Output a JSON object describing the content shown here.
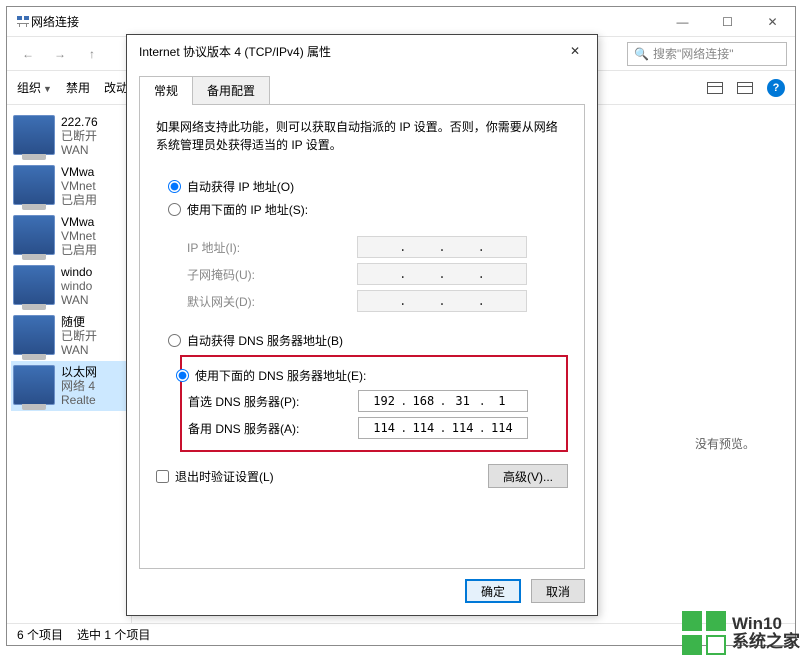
{
  "explorer": {
    "title": "网络连接",
    "search_placeholder": "搜索\"网络连接\"",
    "cmdbar": {
      "organize_label": "组织",
      "disable_label": "禁用",
      "changed_label": "改动的"
    },
    "no_preview": "没有预览。",
    "status": {
      "count": "6 个项目",
      "selected": "选中 1 个项目"
    },
    "items": [
      {
        "name": "222.76",
        "status": "已断开",
        "device": "WAN"
      },
      {
        "name": "VMwa",
        "status": "VMnet",
        "device": "已启用"
      },
      {
        "name": "VMwa",
        "status": "VMnet",
        "device": "已启用"
      },
      {
        "name": "windo",
        "status": "windo",
        "device": "WAN"
      },
      {
        "name": "随便",
        "status": "已断开",
        "device": "WAN"
      },
      {
        "name": "以太网",
        "status": "网络 4",
        "device": "Realte"
      }
    ]
  },
  "dialog": {
    "title": "Internet 协议版本 4 (TCP/IPv4) 属性",
    "tabs": {
      "general": "常规",
      "alt": "备用配置"
    },
    "description": "如果网络支持此功能，则可以获取自动指派的 IP 设置。否则，你需要从网络系统管理员处获得适当的 IP 设置。",
    "ip_auto": "自动获得 IP 地址(O)",
    "ip_manual": "使用下面的 IP 地址(S):",
    "ip_label": "IP 地址(I):",
    "mask_label": "子网掩码(U):",
    "gw_label": "默认网关(D):",
    "dns_auto": "自动获得 DNS 服务器地址(B)",
    "dns_manual": "使用下面的 DNS 服务器地址(E):",
    "dns_pref_label": "首选 DNS 服务器(P):",
    "dns_alt_label": "备用 DNS 服务器(A):",
    "dns_pref": [
      "192",
      "168",
      "31",
      "1"
    ],
    "dns_alt": [
      "114",
      "114",
      "114",
      "114"
    ],
    "validate_label": "退出时验证设置(L)",
    "advanced_label": "高级(V)...",
    "ok_label": "确定",
    "cancel_label": "取消"
  },
  "statusbar_app_label": "个",
  "watermark": {
    "line1": "Win10",
    "line2": "系统之家"
  }
}
